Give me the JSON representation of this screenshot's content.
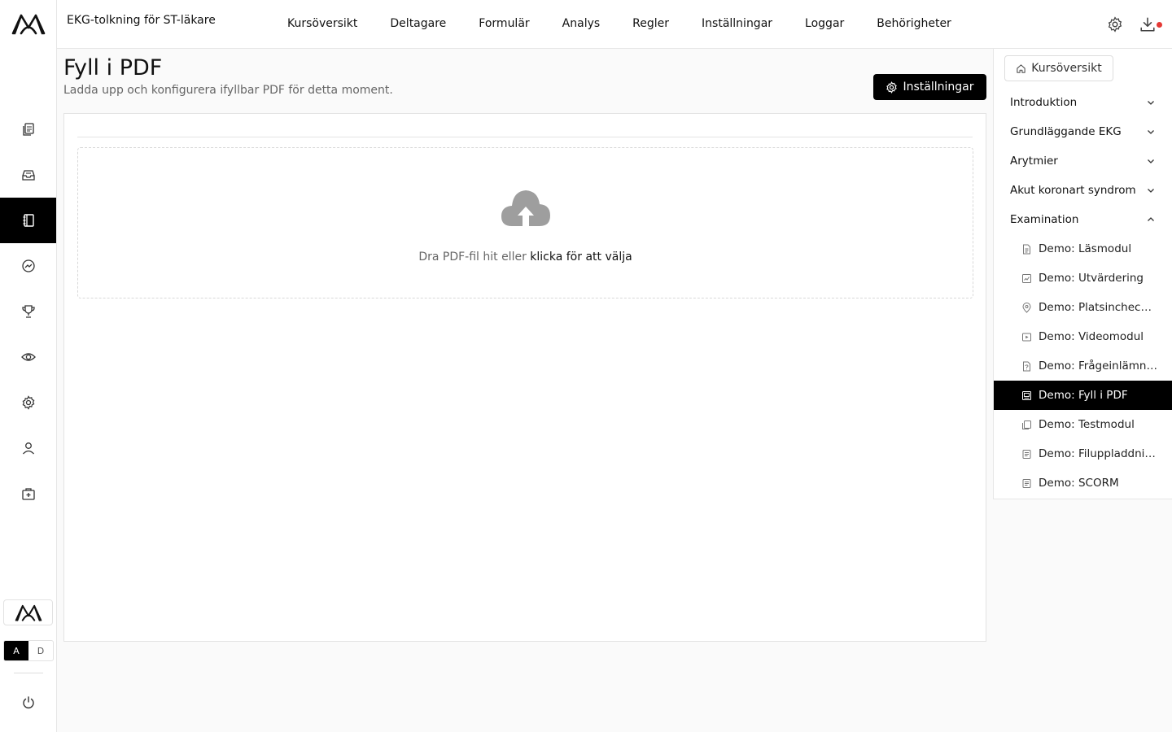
{
  "course": {
    "title": "EKG-tolkning för ST-läkare"
  },
  "topnav": [
    {
      "label": "Kursöversikt"
    },
    {
      "label": "Deltagare"
    },
    {
      "label": "Formulär"
    },
    {
      "label": "Analys"
    },
    {
      "label": "Regler"
    },
    {
      "label": "Inställningar"
    },
    {
      "label": "Loggar"
    },
    {
      "label": "Behörigheter"
    }
  ],
  "rail": {
    "items": [
      "documents-icon",
      "inbox-icon",
      "notebook-icon",
      "analytics-icon",
      "trophy-icon",
      "eye-icon",
      "gear-icon",
      "user-icon",
      "first-aid-icon"
    ],
    "active_index": 2,
    "lang": {
      "a": "A",
      "d": "D",
      "active": "A"
    }
  },
  "page": {
    "title": "Fyll i PDF",
    "subtitle": "Ladda upp och konfigurera ifyllbar PDF för detta moment.",
    "settings_button": "Inställningar"
  },
  "dropzone": {
    "text": "Dra PDF-fil hit eller ",
    "link": "klicka för att välja"
  },
  "sidebar": {
    "home_button": "Kursöversikt",
    "sections": [
      {
        "label": "Introduktion",
        "expanded": false
      },
      {
        "label": "Grundläggande EKG",
        "expanded": false
      },
      {
        "label": "Arytmier",
        "expanded": false
      },
      {
        "label": "Akut koronart syndrom",
        "expanded": false
      },
      {
        "label": "Examination",
        "expanded": true
      }
    ],
    "items": [
      {
        "label": "Demo: Läsmodul",
        "icon": "document-icon"
      },
      {
        "label": "Demo: Utvärdering",
        "icon": "evaluation-icon"
      },
      {
        "label": "Demo: Platsincheckning",
        "icon": "location-icon"
      },
      {
        "label": "Demo: Videomodul",
        "icon": "video-icon"
      },
      {
        "label": "Demo: Frågeinlämning",
        "icon": "file-question-icon"
      },
      {
        "label": "Demo: Fyll i PDF",
        "icon": "pdf-icon",
        "active": true
      },
      {
        "label": "Demo: Testmodul",
        "icon": "test-icon"
      },
      {
        "label": "Demo: Filuppladdning",
        "icon": "file-icon"
      },
      {
        "label": "Demo: SCORM",
        "icon": "file-icon"
      }
    ]
  },
  "colors": {
    "accent": "#000000",
    "notification": "#e53935",
    "muted_text": "#666666"
  }
}
